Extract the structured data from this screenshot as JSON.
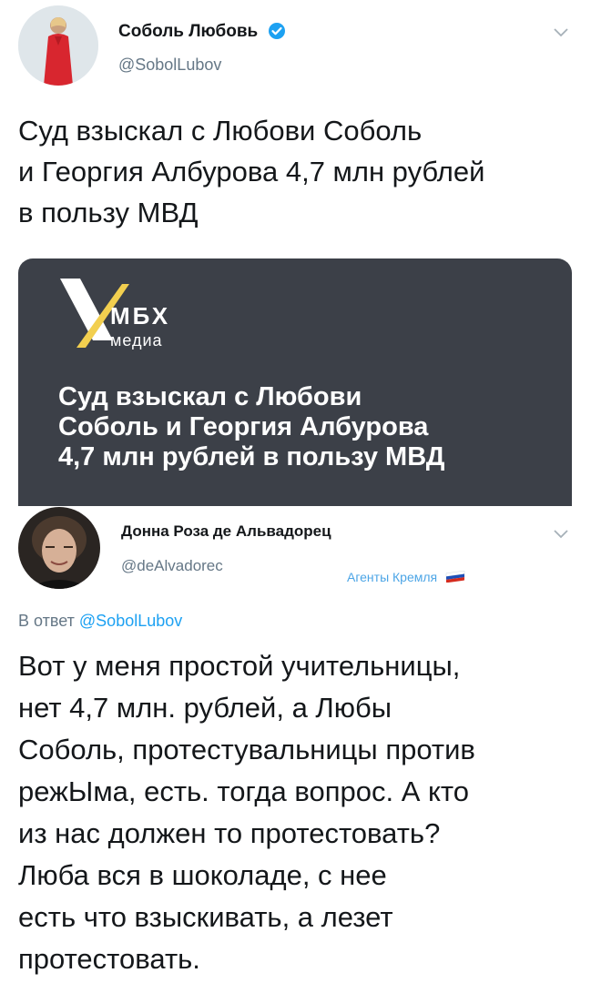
{
  "tweet": {
    "author_name": "Соболь Любовь",
    "author_handle": "@SobolLubov",
    "text_lines": [
      "Суд взыскал с Любови Соболь",
      "и Георгия Албурова 4,7 млн рублей",
      "в пользу МВД"
    ],
    "card": {
      "logo_main": "МБХ",
      "logo_sub": "медиа",
      "headline_lines": [
        "Суд взыскал с Любови",
        "Соболь и Георгия Албурова",
        "4,7 млн рублей в пользу МВД"
      ]
    }
  },
  "reply": {
    "author_name": "Донна Роза де Альвадорец",
    "author_handle": "@deAlvadorec",
    "tag": "Агенты Кремля",
    "reply_prefix": "В ответ",
    "reply_to": "@SobolLubov",
    "text_lines": [
      "Вот у меня простой учительницы,",
      "нет 4,7 млн. рублей, а Любы",
      "Соболь, протестувальницы против",
      "режЫма, есть. тогда вопрос. А кто",
      "из нас должен то протестовать?",
      "Люба вся в шоколаде, с нее",
      "есть что взыскивать, а лезет",
      "протестовать."
    ]
  },
  "colors": {
    "link": "#1da1f2",
    "secondary": "#657786",
    "card_bg": "#3c4048",
    "logo_accent": "#f2cf4f"
  }
}
